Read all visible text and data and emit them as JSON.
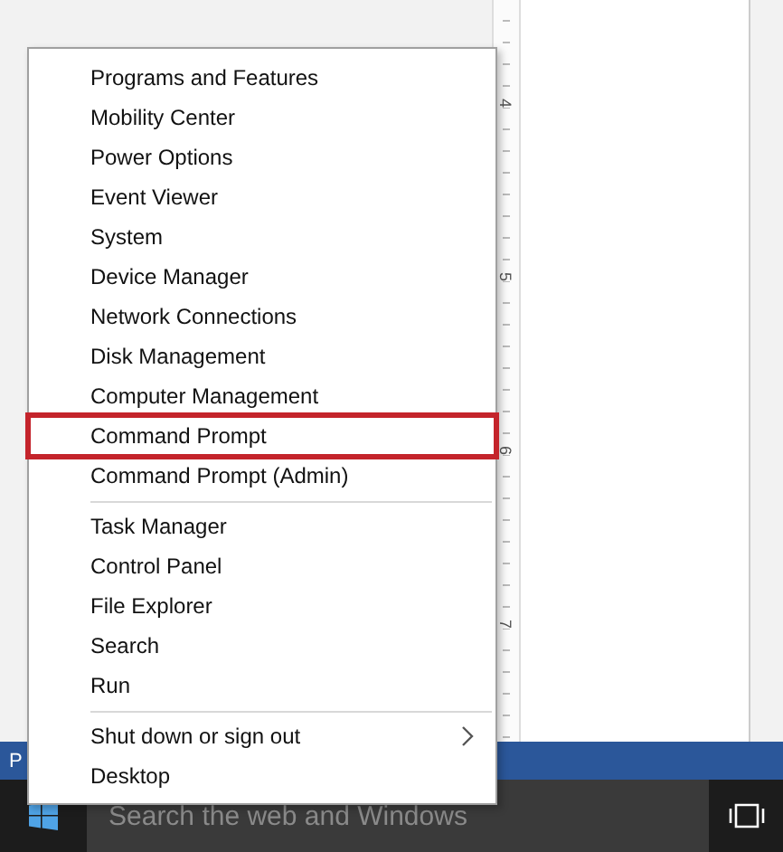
{
  "ruler": {
    "labels": [
      "4",
      "5",
      "6",
      "7"
    ]
  },
  "status_bar": {
    "text": "P"
  },
  "context_menu": {
    "groups": [
      {
        "items": [
          {
            "label": "Programs and Features",
            "highlighted": false
          },
          {
            "label": "Mobility Center",
            "highlighted": false
          },
          {
            "label": "Power Options",
            "highlighted": false
          },
          {
            "label": "Event Viewer",
            "highlighted": false
          },
          {
            "label": "System",
            "highlighted": false
          },
          {
            "label": "Device Manager",
            "highlighted": false
          },
          {
            "label": "Network Connections",
            "highlighted": false
          },
          {
            "label": "Disk Management",
            "highlighted": false
          },
          {
            "label": "Computer Management",
            "highlighted": false
          },
          {
            "label": "Command Prompt",
            "highlighted": true
          },
          {
            "label": "Command Prompt (Admin)",
            "highlighted": false
          }
        ]
      },
      {
        "items": [
          {
            "label": "Task Manager",
            "highlighted": false
          },
          {
            "label": "Control Panel",
            "highlighted": false
          },
          {
            "label": "File Explorer",
            "highlighted": false
          },
          {
            "label": "Search",
            "highlighted": false
          },
          {
            "label": "Run",
            "highlighted": false
          }
        ]
      },
      {
        "items": [
          {
            "label": "Shut down or sign out",
            "highlighted": false,
            "kind": "submenu"
          },
          {
            "label": "Desktop",
            "highlighted": false,
            "kind": "plain"
          }
        ]
      }
    ]
  },
  "taskbar": {
    "search": {
      "placeholder": "Search the web and Windows"
    }
  }
}
